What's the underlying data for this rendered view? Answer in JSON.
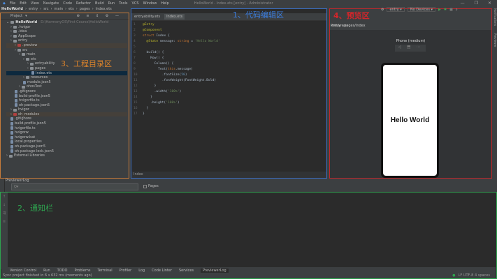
{
  "window": {
    "title": "HelloWorld - Index.ets [entry] - Administrator",
    "controls": [
      "—",
      "❐",
      "✕"
    ]
  },
  "menu": [
    "File",
    "Edit",
    "View",
    "Navigate",
    "Code",
    "Refactor",
    "Build",
    "Run",
    "Tools",
    "VCS",
    "Window",
    "Help"
  ],
  "breadcrumb": [
    "HelloWorld",
    "entry",
    "src",
    "main",
    "ets",
    "pages",
    "Index.ets"
  ],
  "project": {
    "header": "Project",
    "root": "HelloWorld",
    "root_path": "D:\\HarmonyOS\\First Course\\HelloWorld",
    "items": [
      {
        "label": ".hvigor",
        "depth": 1
      },
      {
        "label": ".idea",
        "depth": 1
      },
      {
        "label": "AppScope",
        "depth": 1
      },
      {
        "label": "entry",
        "depth": 1
      },
      {
        "label": ".preview",
        "depth": 2,
        "red": true
      },
      {
        "label": "src",
        "depth": 2
      },
      {
        "label": "main",
        "depth": 3
      },
      {
        "label": "ets",
        "depth": 4
      },
      {
        "label": "entryability",
        "depth": 5
      },
      {
        "label": "pages",
        "depth": 5
      },
      {
        "label": "Index.ets",
        "depth": 6,
        "file": true,
        "selected": true
      },
      {
        "label": "resources",
        "depth": 4
      },
      {
        "label": "module.json5",
        "depth": 4,
        "file": true
      },
      {
        "label": "ohosTest",
        "depth": 3
      },
      {
        "label": ".gitignore",
        "depth": 2,
        "file": true
      },
      {
        "label": "build-profile.json5",
        "depth": 2,
        "file": true
      },
      {
        "label": "hvigorfile.ts",
        "depth": 2,
        "file": true
      },
      {
        "label": "oh-package.json5",
        "depth": 2,
        "file": true
      },
      {
        "label": "hvigor",
        "depth": 1
      },
      {
        "label": "oh_modules",
        "depth": 1,
        "red": true
      },
      {
        "label": ".gitignore",
        "depth": 1,
        "file": true
      },
      {
        "label": "build-profile.json5",
        "depth": 1,
        "file": true
      },
      {
        "label": "hvigorfile.ts",
        "depth": 1,
        "file": true
      },
      {
        "label": "hvigorw",
        "depth": 1,
        "file": true
      },
      {
        "label": "hvigorw.bat",
        "depth": 1,
        "file": true
      },
      {
        "label": "local.properties",
        "depth": 1,
        "file": true
      },
      {
        "label": "oh-package.json5",
        "depth": 1,
        "file": true
      },
      {
        "label": "oh-package-lock.json5",
        "depth": 1,
        "file": true
      },
      {
        "label": "External Libraries",
        "depth": 0
      }
    ]
  },
  "editor": {
    "tabs": [
      "entryability.ets",
      "Index.ets"
    ],
    "footer": "Index",
    "lines": [
      "@Entry",
      "@Component",
      "struct Index {",
      "  @State message: string = 'Hello World'",
      "",
      "  build() {",
      "    Row() {",
      "      Column() {",
      "        Text(this.message)",
      "          .fontSize(50)",
      "          .fontWeight(FontWeight.Bold)",
      "      }",
      "      .width('100%')",
      "    }",
      "    .height('100%')",
      "  }",
      "}"
    ]
  },
  "toolbar": {
    "run_config": "entry",
    "device": "No Devices"
  },
  "previewer": {
    "title": "Previewer",
    "route": "entry : pages/Index",
    "device": "Phone (medium)",
    "screen_text": "Hello World",
    "right_stripe": [
      "Notifications",
      "Previewer"
    ]
  },
  "log": {
    "title": "PreviewerLog",
    "filter_placeholder": "Q▾",
    "pages_label": "Pages"
  },
  "tool_tabs": [
    "Version Control",
    "Run",
    "TODO",
    "Problems",
    "Terminal",
    "Profiler",
    "Log",
    "Code Linter",
    "Services",
    "PreviewerLog"
  ],
  "status": {
    "message": "Sync project finished in 6 s 632 ms (moments ago)",
    "right": "LF  UTF-8  4 spaces"
  },
  "annotations": {
    "editor": "1、代码编辑区",
    "notice": "2、通知栏",
    "project": "3、工程目录区",
    "preview": "4、预览区"
  },
  "colors": {
    "project": "#c87b3a",
    "editor": "#3b6fc4",
    "preview": "#c0282c",
    "notice": "#2ea44f"
  }
}
